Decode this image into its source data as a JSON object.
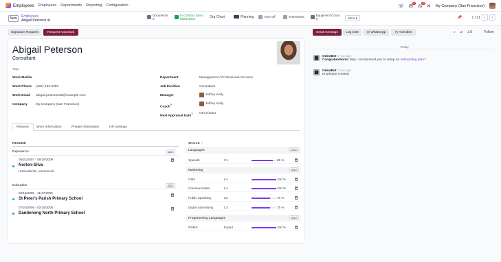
{
  "topbar": {
    "app_name": "Employees",
    "menus": [
      "Employees",
      "Departments",
      "Reporting",
      "Configuration"
    ],
    "badges": {
      "activity": "5",
      "chat": "28"
    },
    "company": "My Company (San Francisco)"
  },
  "control": {
    "new_label": "New",
    "breadcrumb_parent": "Employees",
    "breadcrumb_current": "Abigail Peterson",
    "smart_buttons": [
      {
        "label": "Documents",
        "sub": "0",
        "color": "#6b7280"
      },
      {
        "label": "In Contract Since",
        "sub": "09/01/2023",
        "color": "#16a34a"
      },
      {
        "label": "Org Chart",
        "sub": "",
        "color": ""
      },
      {
        "label": "Planning",
        "sub": "",
        "color": "#374151"
      },
      {
        "label": "Time Off",
        "sub": "",
        "color": "#6b7280"
      },
      {
        "label": "Timesheets",
        "sub": "",
        "color": "#6b7280"
      },
      {
        "label": "Equipment Count",
        "sub": "0",
        "color": "#6b7280"
      }
    ],
    "more_label": "More ▾",
    "pager": "1 / 21"
  },
  "actions": {
    "signature_request": "Signature Request",
    "request_appraisal": "Request Appraisal"
  },
  "employee": {
    "name": "Abigail Peterson",
    "job_title": "Consultant",
    "tags_label": "Tags"
  },
  "fields_left": [
    {
      "label": "Work Mobile",
      "value": ""
    },
    {
      "label": "Work Phone",
      "value": "(482)-233-3393"
    },
    {
      "label": "Work Email",
      "value": "abigail.peterson39@example.com"
    },
    {
      "label": "Company",
      "value": "My Company (San Francisco)"
    }
  ],
  "fields_right": [
    {
      "label": "Department",
      "value": "Management / Professional Services"
    },
    {
      "label": "Job Position",
      "value": "Consultant"
    },
    {
      "label": "Manager",
      "value": "Jeffrey Kelly"
    },
    {
      "label": "Coach",
      "value": "Jeffrey Kelly"
    },
    {
      "label": "Next Appraisal Date",
      "value": "04/17/2024"
    }
  ],
  "tabs": [
    "Resume",
    "Work Information",
    "Private Information",
    "HR Settings"
  ],
  "resume": {
    "title": "RESUME",
    "add_label": "ADD",
    "experience_label": "Experience",
    "education_label": "Education",
    "experience": [
      {
        "dates": "05/21/2007 - 06/18/2009",
        "org": "Norton-Silva",
        "desc": "Horticulturist, commercial"
      }
    ],
    "education": [
      {
        "dates": "03/16/2006 - 11/17/2008",
        "org": "St Peter's Parish Primary School"
      },
      {
        "dates": "07/20/2005 - 02/15/2008",
        "org": "Dandenong North Primary School"
      }
    ]
  },
  "skills": {
    "title": "SKILLS",
    "add_label": "ADD",
    "groups": [
      {
        "name": "Languages",
        "items": [
          {
            "name": "Spanish",
            "level": "C1",
            "percent": 85,
            "pct_label": "85 %"
          }
        ]
      },
      {
        "name": "Marketing",
        "items": [
          {
            "name": "CMS",
            "level": "L4",
            "percent": 100,
            "pct_label": "100 %"
          },
          {
            "name": "Communication",
            "level": "L4",
            "percent": 100,
            "pct_label": "100 %"
          },
          {
            "name": "Public Speaking",
            "level": "L3",
            "percent": 75,
            "pct_label": "75 %"
          },
          {
            "name": "Digital advertising",
            "level": "L3",
            "percent": 75,
            "pct_label": "75 %"
          }
        ]
      },
      {
        "name": "Programming Languages",
        "items": [
          {
            "name": "RDMS",
            "level": "Expert",
            "percent": 100,
            "pct_label": "100 %"
          }
        ]
      }
    ]
  },
  "chatter": {
    "send_message": "Send message",
    "log_note": "Log note",
    "whatsapp": "WhatsApp",
    "activities": "Activities",
    "followers": "0",
    "follow": "Follow",
    "today": "Today",
    "messages": [
      {
        "author": "OdooBot",
        "time": "1 hour ago",
        "text_bold": "Congratulations!",
        "text": "May I recommend you to setup an",
        "link": "onboarding plan?"
      },
      {
        "author": "OdooBot",
        "time": "1 hour ago",
        "text_bold": "",
        "text": "Employee created",
        "link": ""
      }
    ]
  }
}
